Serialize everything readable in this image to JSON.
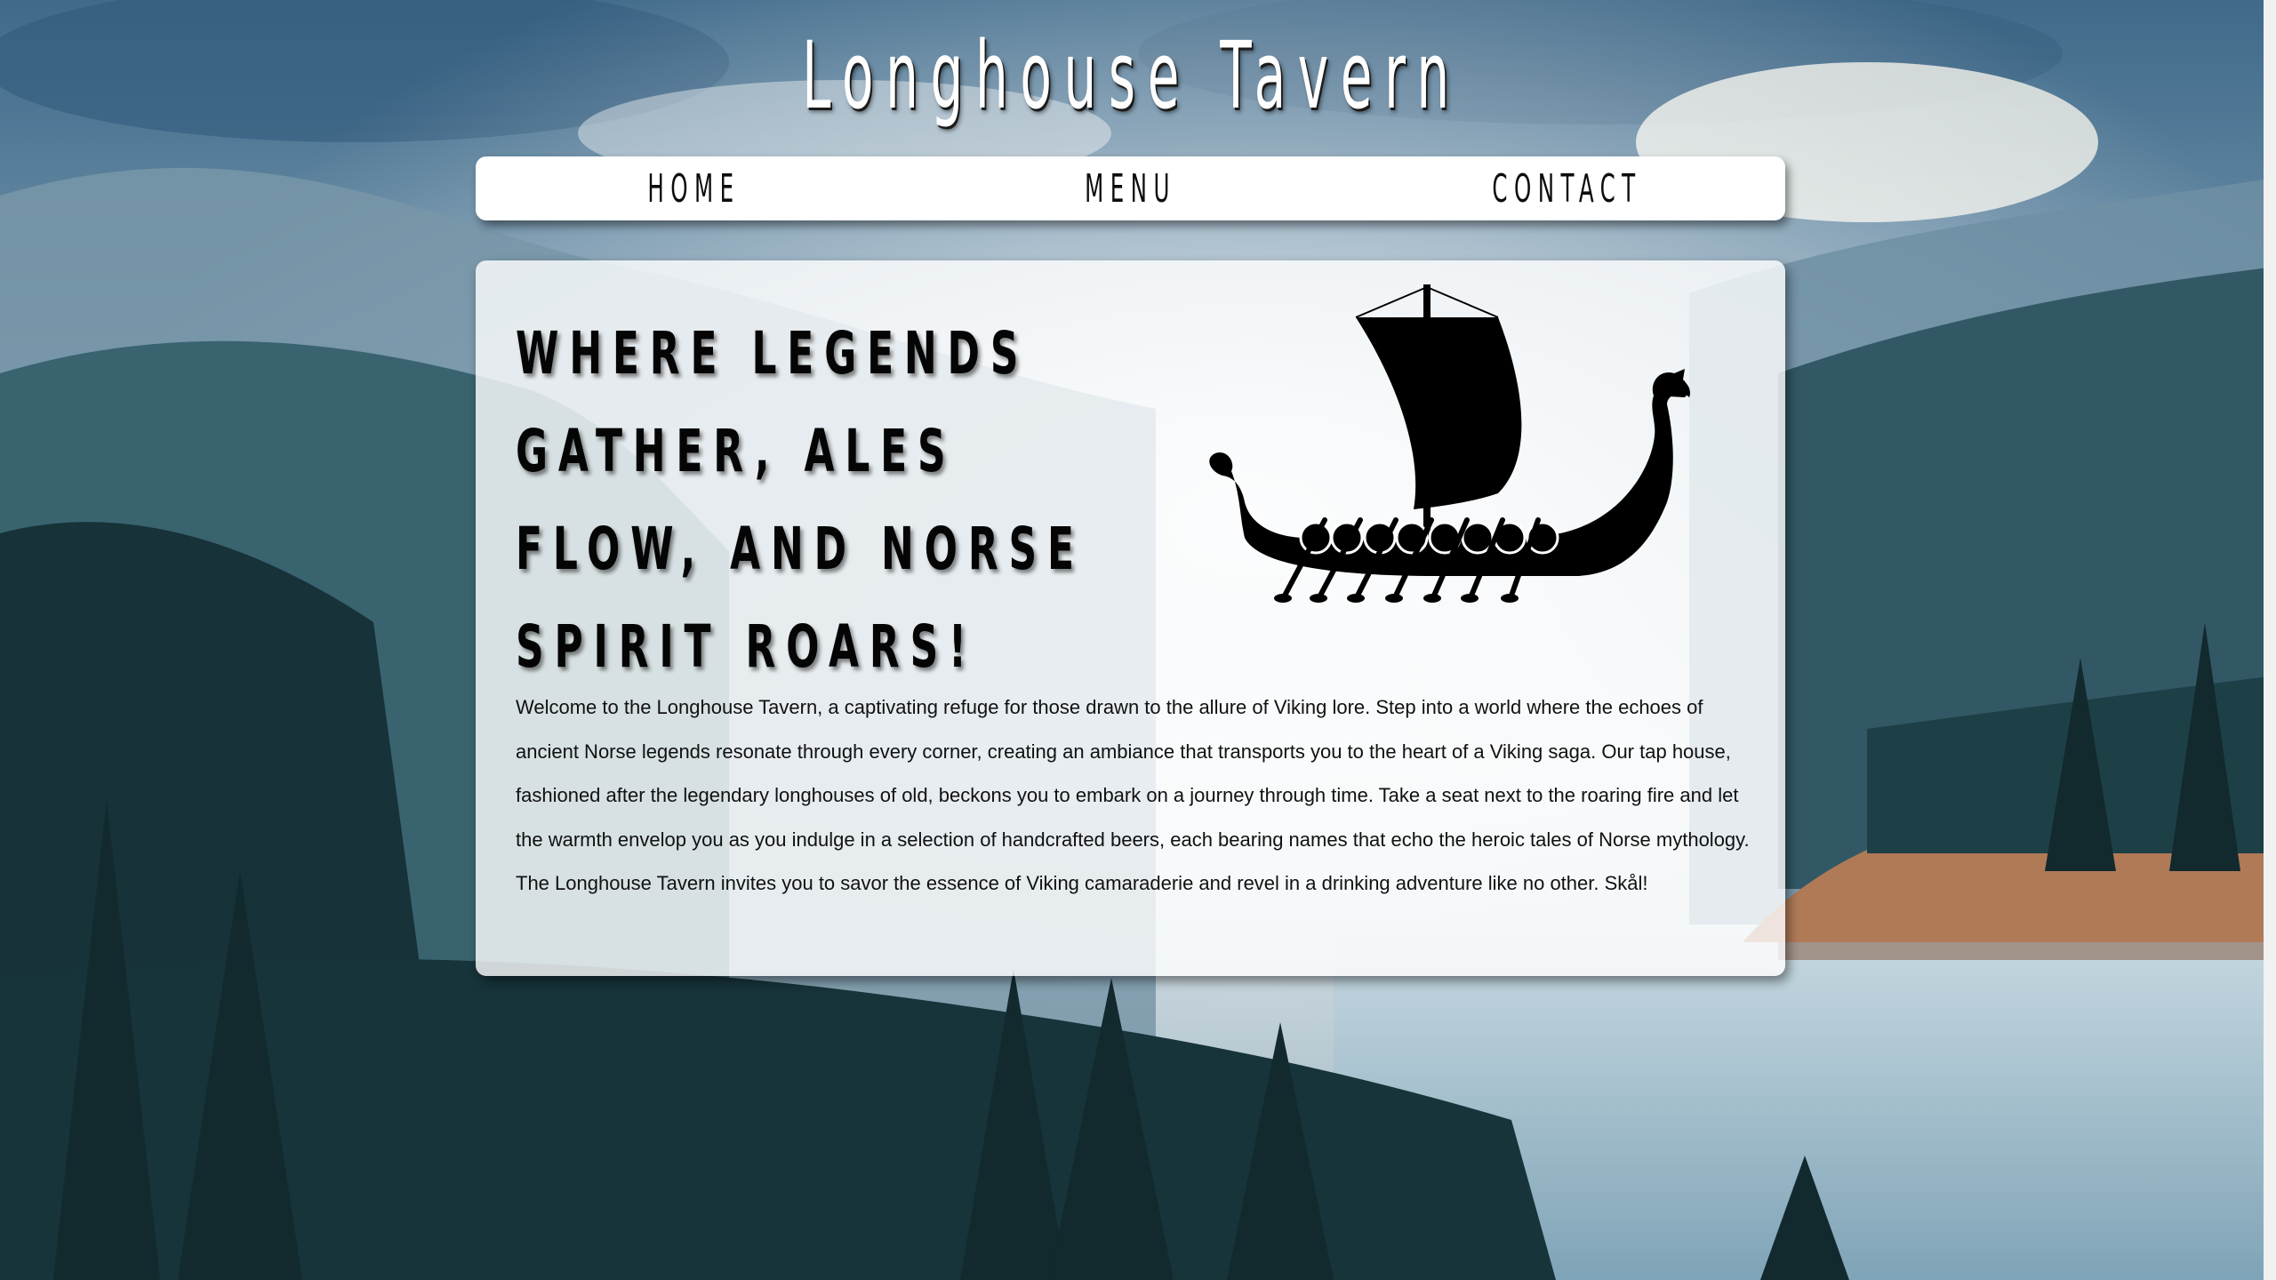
{
  "site": {
    "title": "Longhouse Tavern"
  },
  "nav": {
    "items": [
      {
        "label": "Home"
      },
      {
        "label": "Menu"
      },
      {
        "label": "Contact"
      }
    ]
  },
  "hero": {
    "tagline": "Where legends gather, ales flow, and Norse spirit roars!",
    "image": "viking-longship-icon",
    "welcome_text": "Welcome to the Longhouse Tavern, a captivating refuge for those drawn to the allure of Viking lore. Step into a world where the echoes of ancient Norse legends resonate through every corner, creating an ambiance that transports you to the heart of a Viking saga. Our tap house, fashioned after the legendary longhouses of old, beckons you to embark on a journey through time. Take a seat next to the roaring fire and let the warmth envelop you as you indulge in a selection of handcrafted beers, each bearing names that echo the heroic tales of Norse mythology. The Longhouse Tavern invites you to savor the essence of Viking camaraderie and revel in a drinking adventure like no other. Skål!"
  },
  "colors": {
    "title_text": "#ffffff",
    "card_background": "#ffffff",
    "text": "#111111",
    "sky": "#5f7f93",
    "forest": "#1f3d43",
    "lake": "#a9c4d2"
  }
}
